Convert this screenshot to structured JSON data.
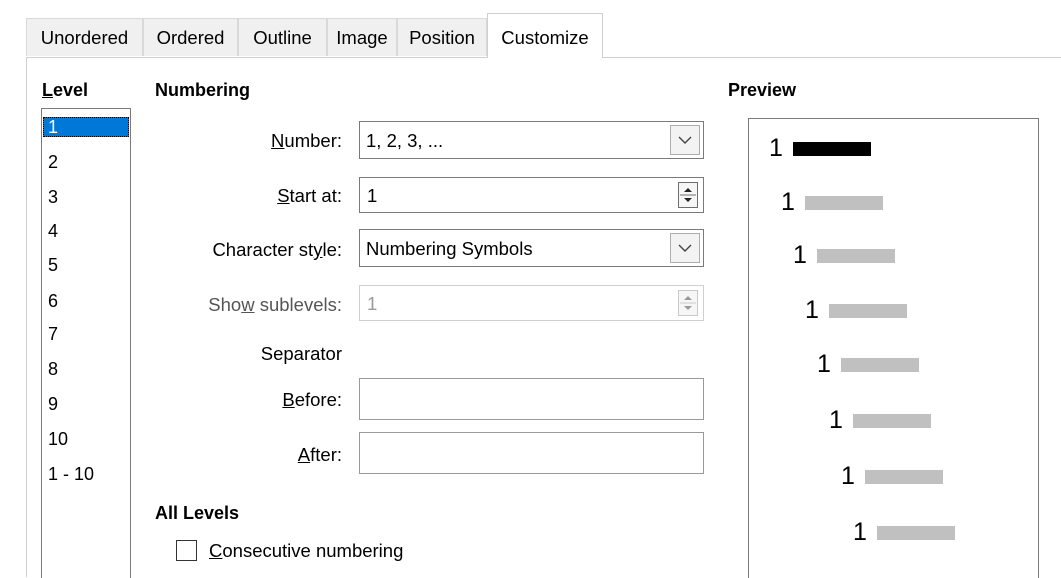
{
  "tabs": [
    {
      "label": "Unordered"
    },
    {
      "label": "Ordered"
    },
    {
      "label": "Outline"
    },
    {
      "label": "Image"
    },
    {
      "label": "Position"
    },
    {
      "label": "Customize",
      "active": true
    }
  ],
  "level": {
    "title": "Level",
    "items": [
      "1",
      "2",
      "3",
      "4",
      "5",
      "6",
      "7",
      "8",
      "9",
      "10",
      "1 - 10"
    ],
    "selected": "1"
  },
  "numbering": {
    "title": "Numbering",
    "number": {
      "label": "Number:",
      "value": "1, 2, 3, ..."
    },
    "start_at": {
      "label": "Start at:",
      "value": "1"
    },
    "character_style": {
      "label": "Character style:",
      "value": "Numbering Symbols"
    },
    "show_sublevels": {
      "label": "Show sublevels:",
      "value": "1",
      "disabled": true
    },
    "separator_label": "Separator",
    "before": {
      "label": "Before:",
      "value": ""
    },
    "after": {
      "label": "After:",
      "value": ""
    }
  },
  "all_levels": {
    "title": "All Levels",
    "consecutive_numbering": {
      "label": "Consecutive numbering",
      "checked": false
    }
  },
  "preview": {
    "title": "Preview",
    "lines": [
      {
        "number": "1",
        "highlighted": true
      },
      {
        "number": "1"
      },
      {
        "number": "1"
      },
      {
        "number": "1"
      },
      {
        "number": "1"
      },
      {
        "number": "1"
      },
      {
        "number": "1"
      },
      {
        "number": "1"
      }
    ],
    "highlight_color": "#000000",
    "placeholder_color": "#c0c0c0"
  },
  "icons": {
    "dropdown": "chevron-down-icon",
    "spin": "spin-up-down-icon",
    "checkbox": "checkbox-unchecked-icon"
  }
}
